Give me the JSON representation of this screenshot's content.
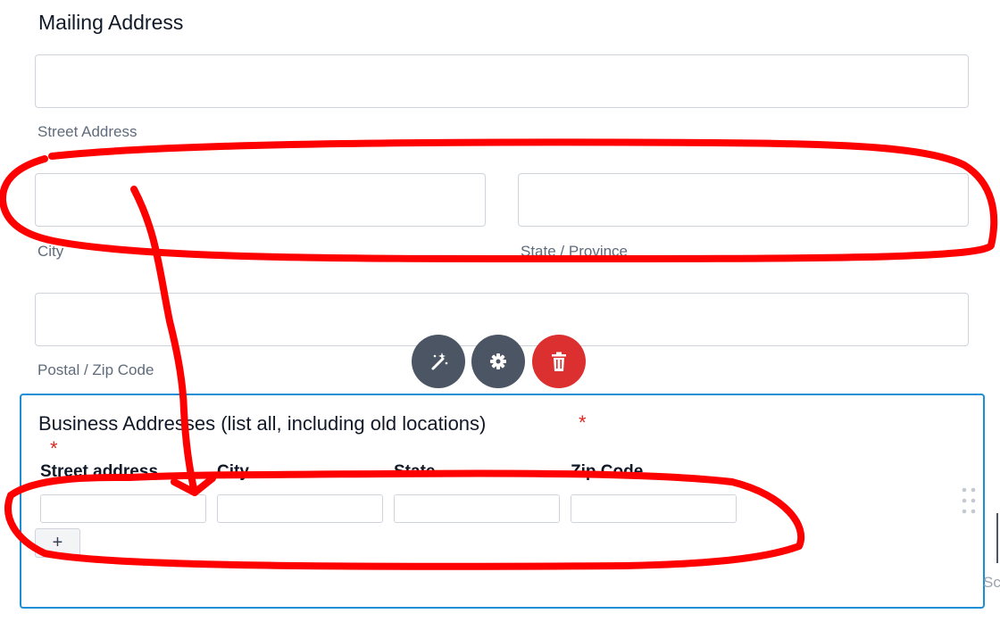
{
  "mailing": {
    "title": "Mailing Address",
    "street_label": "Street Address",
    "city_label": "City",
    "state_label": "State / Province",
    "postal_label": "Postal / Zip Code"
  },
  "toolbar": {
    "icons": [
      "magic-wand-icon",
      "gear-icon",
      "trash-icon"
    ]
  },
  "business": {
    "title": "Business Addresses (list all, including old locations)",
    "required_mark": "*",
    "columns": [
      "Street address",
      "City",
      "State",
      "Zip Code"
    ],
    "add_row_label": "+",
    "edge_text": "Sc"
  },
  "colors": {
    "annotation": "#ff0000",
    "selection": "#1a8fd6",
    "delete": "#dc2f2f",
    "tool": "#4b5563"
  }
}
